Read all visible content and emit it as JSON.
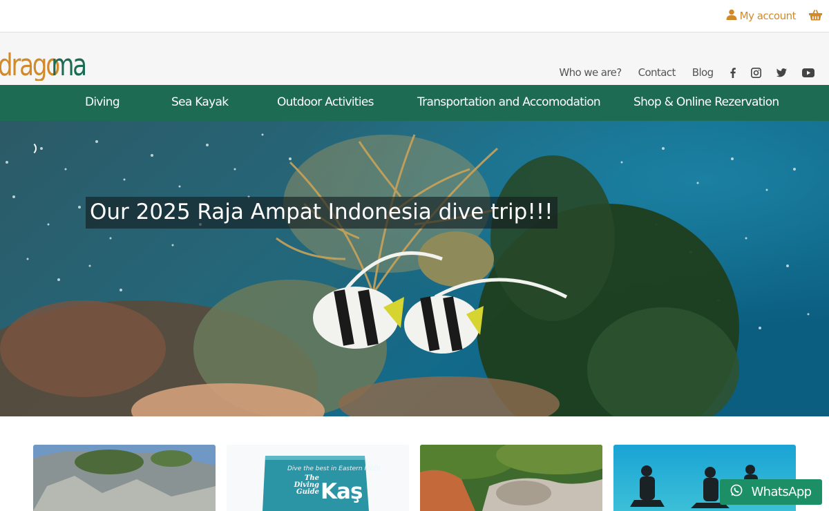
{
  "topbar": {
    "account_label": "My account",
    "account_icon": "user-icon",
    "cart_icon": "basket-icon",
    "accent_color": "#d08a2a"
  },
  "header": {
    "logo_text": "dragoman",
    "util_links": [
      "Who we are?",
      "Contact",
      "Blog"
    ],
    "social_icons": [
      "facebook-icon",
      "instagram-icon",
      "twitter-icon",
      "youtube-icon"
    ],
    "language": "E"
  },
  "mainnav": {
    "items": [
      "Diving",
      "Sea Kayak",
      "Outdoor Activities",
      "Transportation and Accomodation",
      "Shop & Online Rezervation"
    ],
    "color": "#1d6b52"
  },
  "hero": {
    "caption": "Our 2025 Raja Ampat Indonesia dive trip!!!"
  },
  "cards": {
    "book_cover": {
      "tagline": "Dive the best in Eastern MED!",
      "title_small_1": "The",
      "title_small_2": "Diving",
      "title_small_3": "Guide",
      "title_big": "Kaş"
    }
  },
  "whatsapp": {
    "label": "WhatsApp",
    "color": "#1d8f67"
  }
}
